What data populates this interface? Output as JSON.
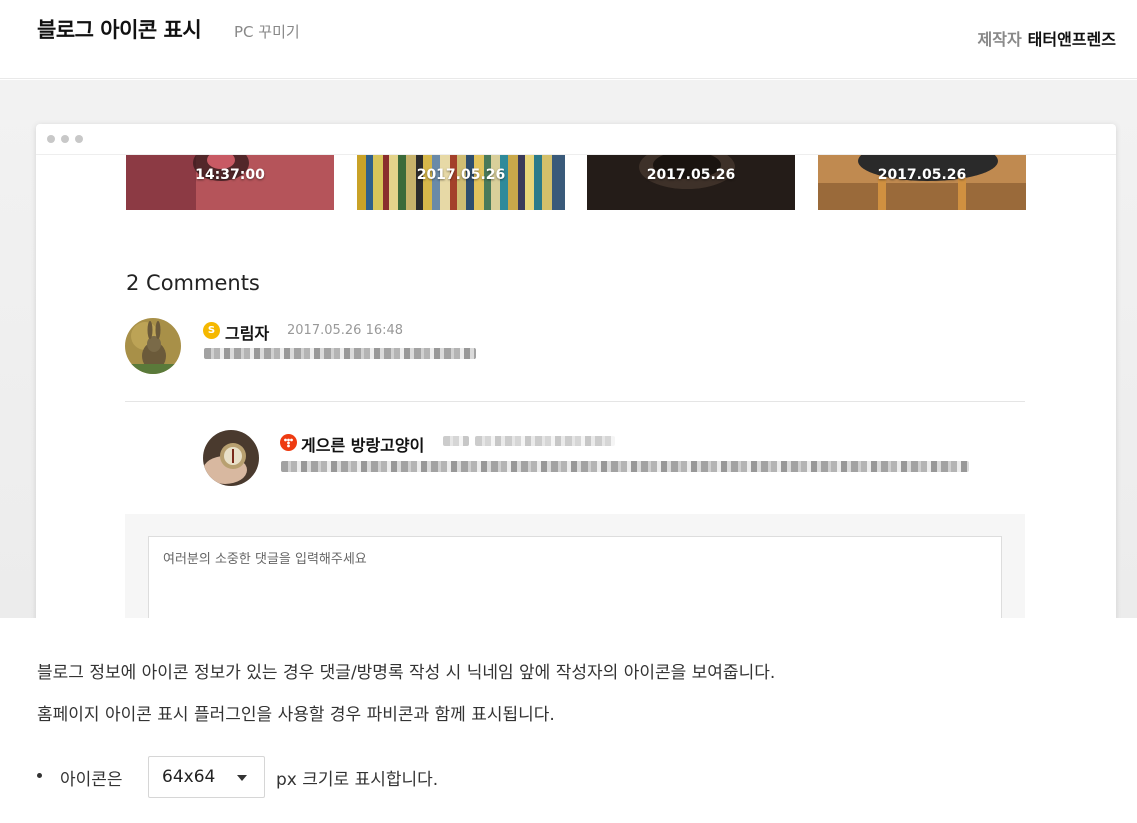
{
  "header": {
    "title": "블로그 아이콘 표시",
    "subtitle": "PC 꾸미기",
    "maker_label": "제작자",
    "maker_name": "태터앤프렌즈"
  },
  "preview": {
    "thumbnails": [
      {
        "date": "14:37:00",
        "color": "#b04a52"
      },
      {
        "date": "2017.05.26",
        "color": "#7a6a3a"
      },
      {
        "date": "2017.05.26",
        "color": "#2a2320"
      },
      {
        "date": "2017.05.26",
        "color": "#8a5a2e"
      }
    ],
    "comments_title": "2 Comments",
    "comments": [
      {
        "author": "그림자",
        "date": "2017.05.26 16:48",
        "badge_text": "S",
        "badge_color": "#f5b800",
        "avatar_icon": "rabbit-avatar"
      },
      {
        "author": "게으른 방랑고양이",
        "badge_color": "#ee3b11",
        "avatar_icon": "compass-avatar"
      }
    ],
    "comment_placeholder": "여러분의 소중한 댓글을 입력해주세요"
  },
  "description": {
    "line1": "블로그 정보에 아이콘 정보가 있는 경우 댓글/방명록 작성 시 닉네임 앞에 작성자의 아이콘을 보여줍니다.",
    "line2": "홈페이지 아이콘 표시 플러그인을 사용할 경우 파비콘과 함께 표시됩니다."
  },
  "option": {
    "label": "아이콘은",
    "selected": "64x64",
    "suffix": "px 크기로 표시합니다."
  }
}
